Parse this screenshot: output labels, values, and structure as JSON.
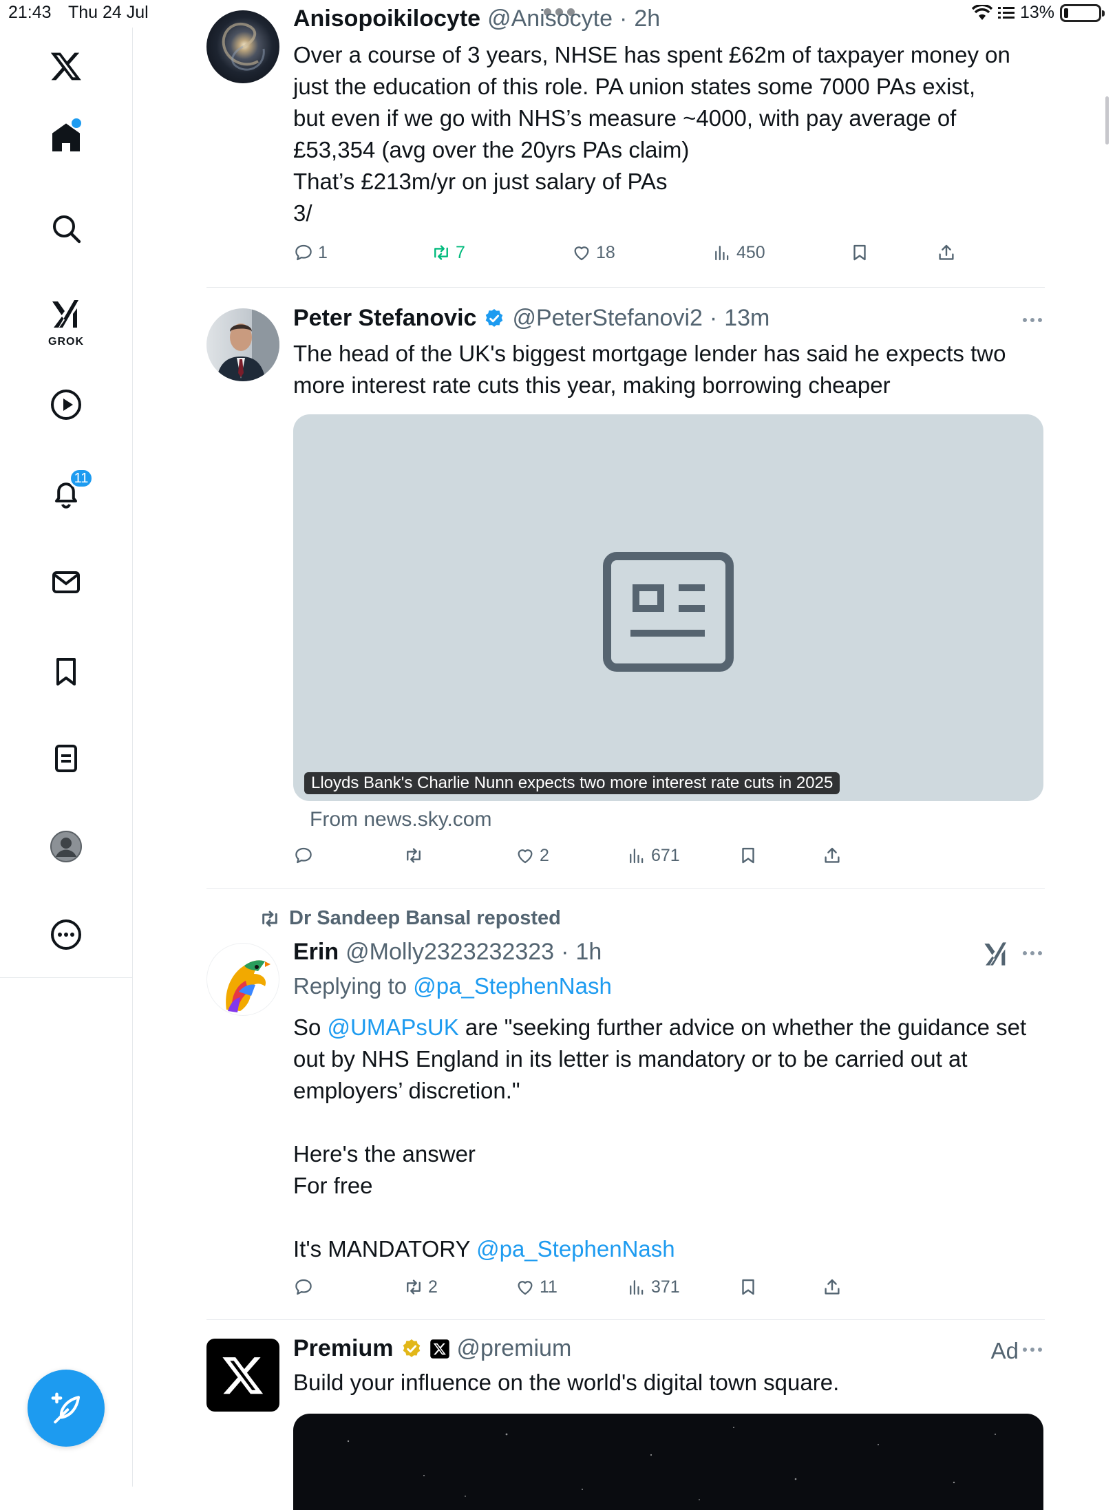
{
  "status_bar": {
    "time": "21:43",
    "date": "Thu 24 Jul",
    "battery": "13%"
  },
  "sidebar": {
    "notifications_badge": "11",
    "grok_label": "GROK"
  },
  "colors": {
    "accent": "#1d9bf0",
    "retweet_green": "#00ba7c",
    "secondary_text": "#536471"
  },
  "tweets": [
    {
      "name": "Anisopoikilocyte",
      "handle": "@Anisocyte",
      "time": "2h",
      "text": "Over a course of 3 years, NHSE has spent £62m of taxpayer money on\njust the education of this role. PA union states some 7000 PAs exist,\nbut even if we go with NHS’s measure ~4000, with pay average of\n£53,354 (avg over the 20yrs PAs claim)\nThat’s £213m/yr on just salary of PAs\n3/",
      "replies": "1",
      "reposts": "7",
      "likes": "18",
      "views": "450"
    },
    {
      "name": "Peter Stefanovic",
      "handle": "@PeterStefanovi2",
      "time": "13m",
      "text": "The head of the UK's biggest mortgage lender has said he expects two\nmore interest rate cuts this year, making borrowing cheaper",
      "card_caption": "Lloyds Bank's Charlie Nunn expects two more interest rate cuts in 2025",
      "card_source": "From news.sky.com",
      "likes": "2",
      "views": "671"
    },
    {
      "reposted_by": "Dr Sandeep Bansal reposted",
      "name": "Erin",
      "handle": "@Molly2323232323",
      "time": "1h",
      "replying_prefix": "Replying to ",
      "replying_to": "@pa_StephenNash",
      "text_a": "So ",
      "mention_1": "@UMAPsUK",
      "text_b": " are \"seeking further advice on whether the guidance set\nout by NHS England in its letter is mandatory or to be carried out at\nemployers’ discretion.\"\n\nHere's the answer\nFor free\n\nIt's MANDATORY ",
      "mention_2": "@pa_StephenNash",
      "reposts": "2",
      "likes": "11",
      "views": "371"
    },
    {
      "name": "Premium",
      "handle": "@premium",
      "ad_label": "Ad",
      "text": "Build your influence on the world's digital town square."
    }
  ]
}
